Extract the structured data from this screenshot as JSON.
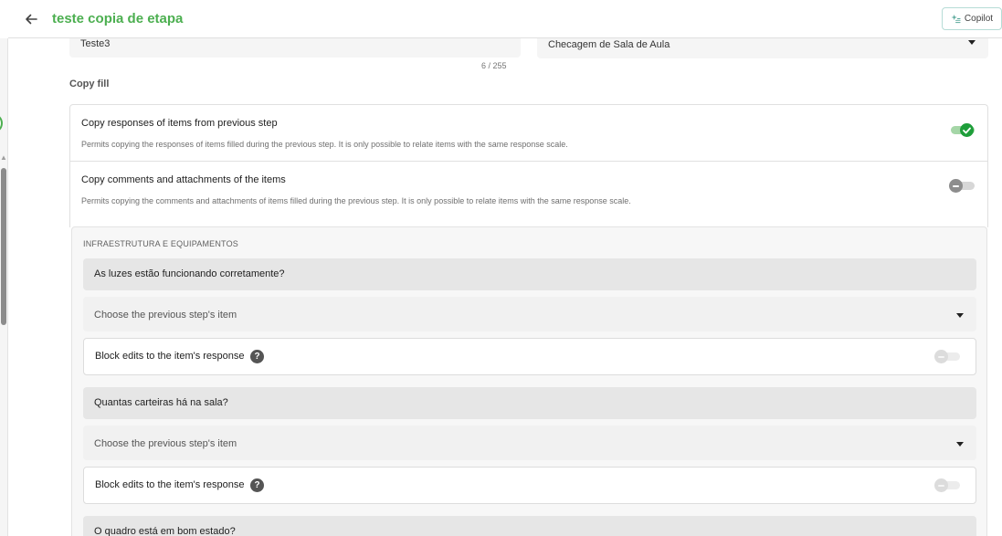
{
  "header": {
    "title": "teste copia de etapa",
    "copilot_label": "Copilot"
  },
  "step_form": {
    "name_value": "Teste3",
    "char_counter": "6 / 255",
    "checklist_value": "Checagem de Sala de Aula"
  },
  "copy_fill": {
    "title": "Copy fill",
    "options": [
      {
        "title": "Copy responses of items from previous step",
        "description": "Permits copying the responses of items filled during the previous step. It is only possible to relate items with the same response scale.",
        "enabled": true
      },
      {
        "title": "Copy comments and attachments of the items",
        "description": "Permits copying the comments and attachments of items filled during the previous step. It is only possible to relate items with the same response scale.",
        "enabled": false
      }
    ]
  },
  "items_section": {
    "group_label": "INFRAESTRUTURA E EQUIPAMENTOS",
    "select_placeholder": "Choose the previous step's item",
    "block_label": "Block edits to the item's response",
    "help_glyph": "?",
    "questions": [
      "As luzes estão funcionando corretamente?",
      "Quantas carteiras há na sala?",
      "O quadro está em bom estado?"
    ]
  },
  "colors": {
    "brand_green": "#4caf50",
    "toggle_on": "#1e9e3a"
  },
  "icons": {
    "back": "arrow-left-icon",
    "copilot": "sparkle-icon",
    "toggle_on": "check-icon",
    "help": "question-mark-icon"
  }
}
